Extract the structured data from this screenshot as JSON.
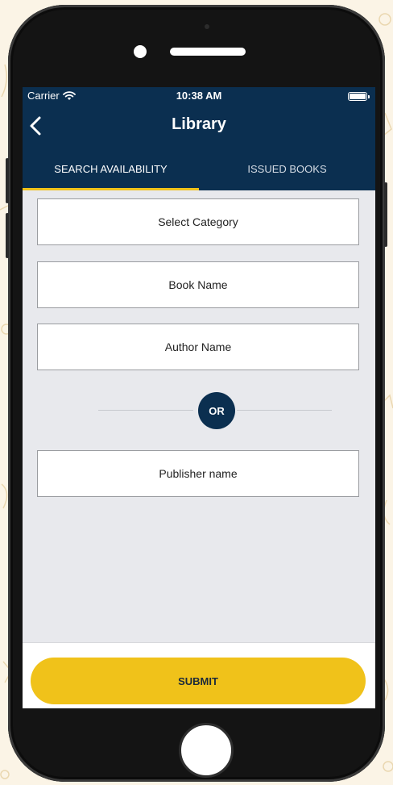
{
  "status_bar": {
    "carrier": "Carrier",
    "time": "10:38 AM",
    "wifi_icon": "wifi-icon",
    "battery_icon": "battery-icon"
  },
  "nav": {
    "title": "Library",
    "back_icon": "chevron-left-icon"
  },
  "tabs": [
    {
      "label": "SEARCH AVAILABILITY",
      "active": true
    },
    {
      "label": "ISSUED BOOKS",
      "active": false
    }
  ],
  "form": {
    "category_label": "Select Category",
    "book_name_label": "Book Name",
    "author_name_label": "Author Name",
    "or_label": "OR",
    "publisher_label": "Publisher name"
  },
  "footer": {
    "submit_label": "SUBMIT"
  },
  "colors": {
    "primary": "#0b2f50",
    "accent": "#f0c21a",
    "screen_background": "#e8e9ed",
    "page_background": "#fbf4e6"
  }
}
